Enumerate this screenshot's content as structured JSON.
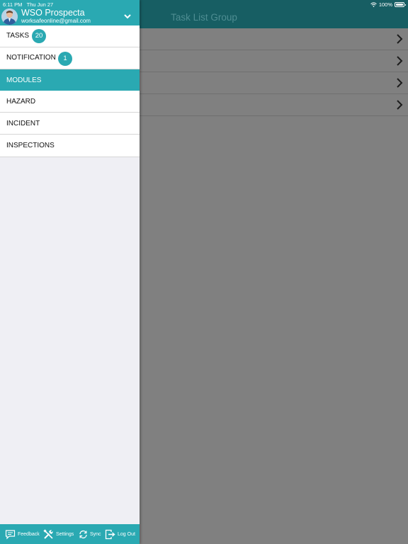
{
  "status_bar": {
    "time": "6:11 PM",
    "date": "Thu Jun 27",
    "battery": "100%",
    "battery_level": 1.0,
    "wifi_icon": "wifi-icon"
  },
  "main": {
    "title": "Task List Group",
    "rows": [
      {
        "chevron_icon": "chevron-right-icon"
      },
      {
        "chevron_icon": "chevron-right-icon"
      },
      {
        "chevron_icon": "chevron-right-icon"
      },
      {
        "chevron_icon": "chevron-right-icon"
      }
    ]
  },
  "drawer": {
    "user": {
      "name": "WSO Prospecta",
      "email": "worksafeonline@gmail.com",
      "avatar_icon": "user-avatar",
      "expand_icon": "chevron-down-icon"
    },
    "menu": [
      {
        "label": "TASKS",
        "badge": "20"
      },
      {
        "label": "NOTIFICATION",
        "badge": "1"
      }
    ],
    "section_header": "MODULES",
    "modules": [
      {
        "label": "HAZARD"
      },
      {
        "label": "INCIDENT"
      },
      {
        "label": "INSPECTIONS"
      }
    ],
    "footer": [
      {
        "label": "Feedback",
        "icon": "feedback-icon"
      },
      {
        "label": "Settings",
        "icon": "settings-icon"
      },
      {
        "label": "Sync",
        "icon": "sync-icon"
      },
      {
        "label": "Log Out",
        "icon": "logout-icon"
      }
    ]
  },
  "colors": {
    "accent": "#2aa9b2",
    "header_dark": "#175e63",
    "overlay": "#808080",
    "drawer_bg": "#efeff4"
  }
}
